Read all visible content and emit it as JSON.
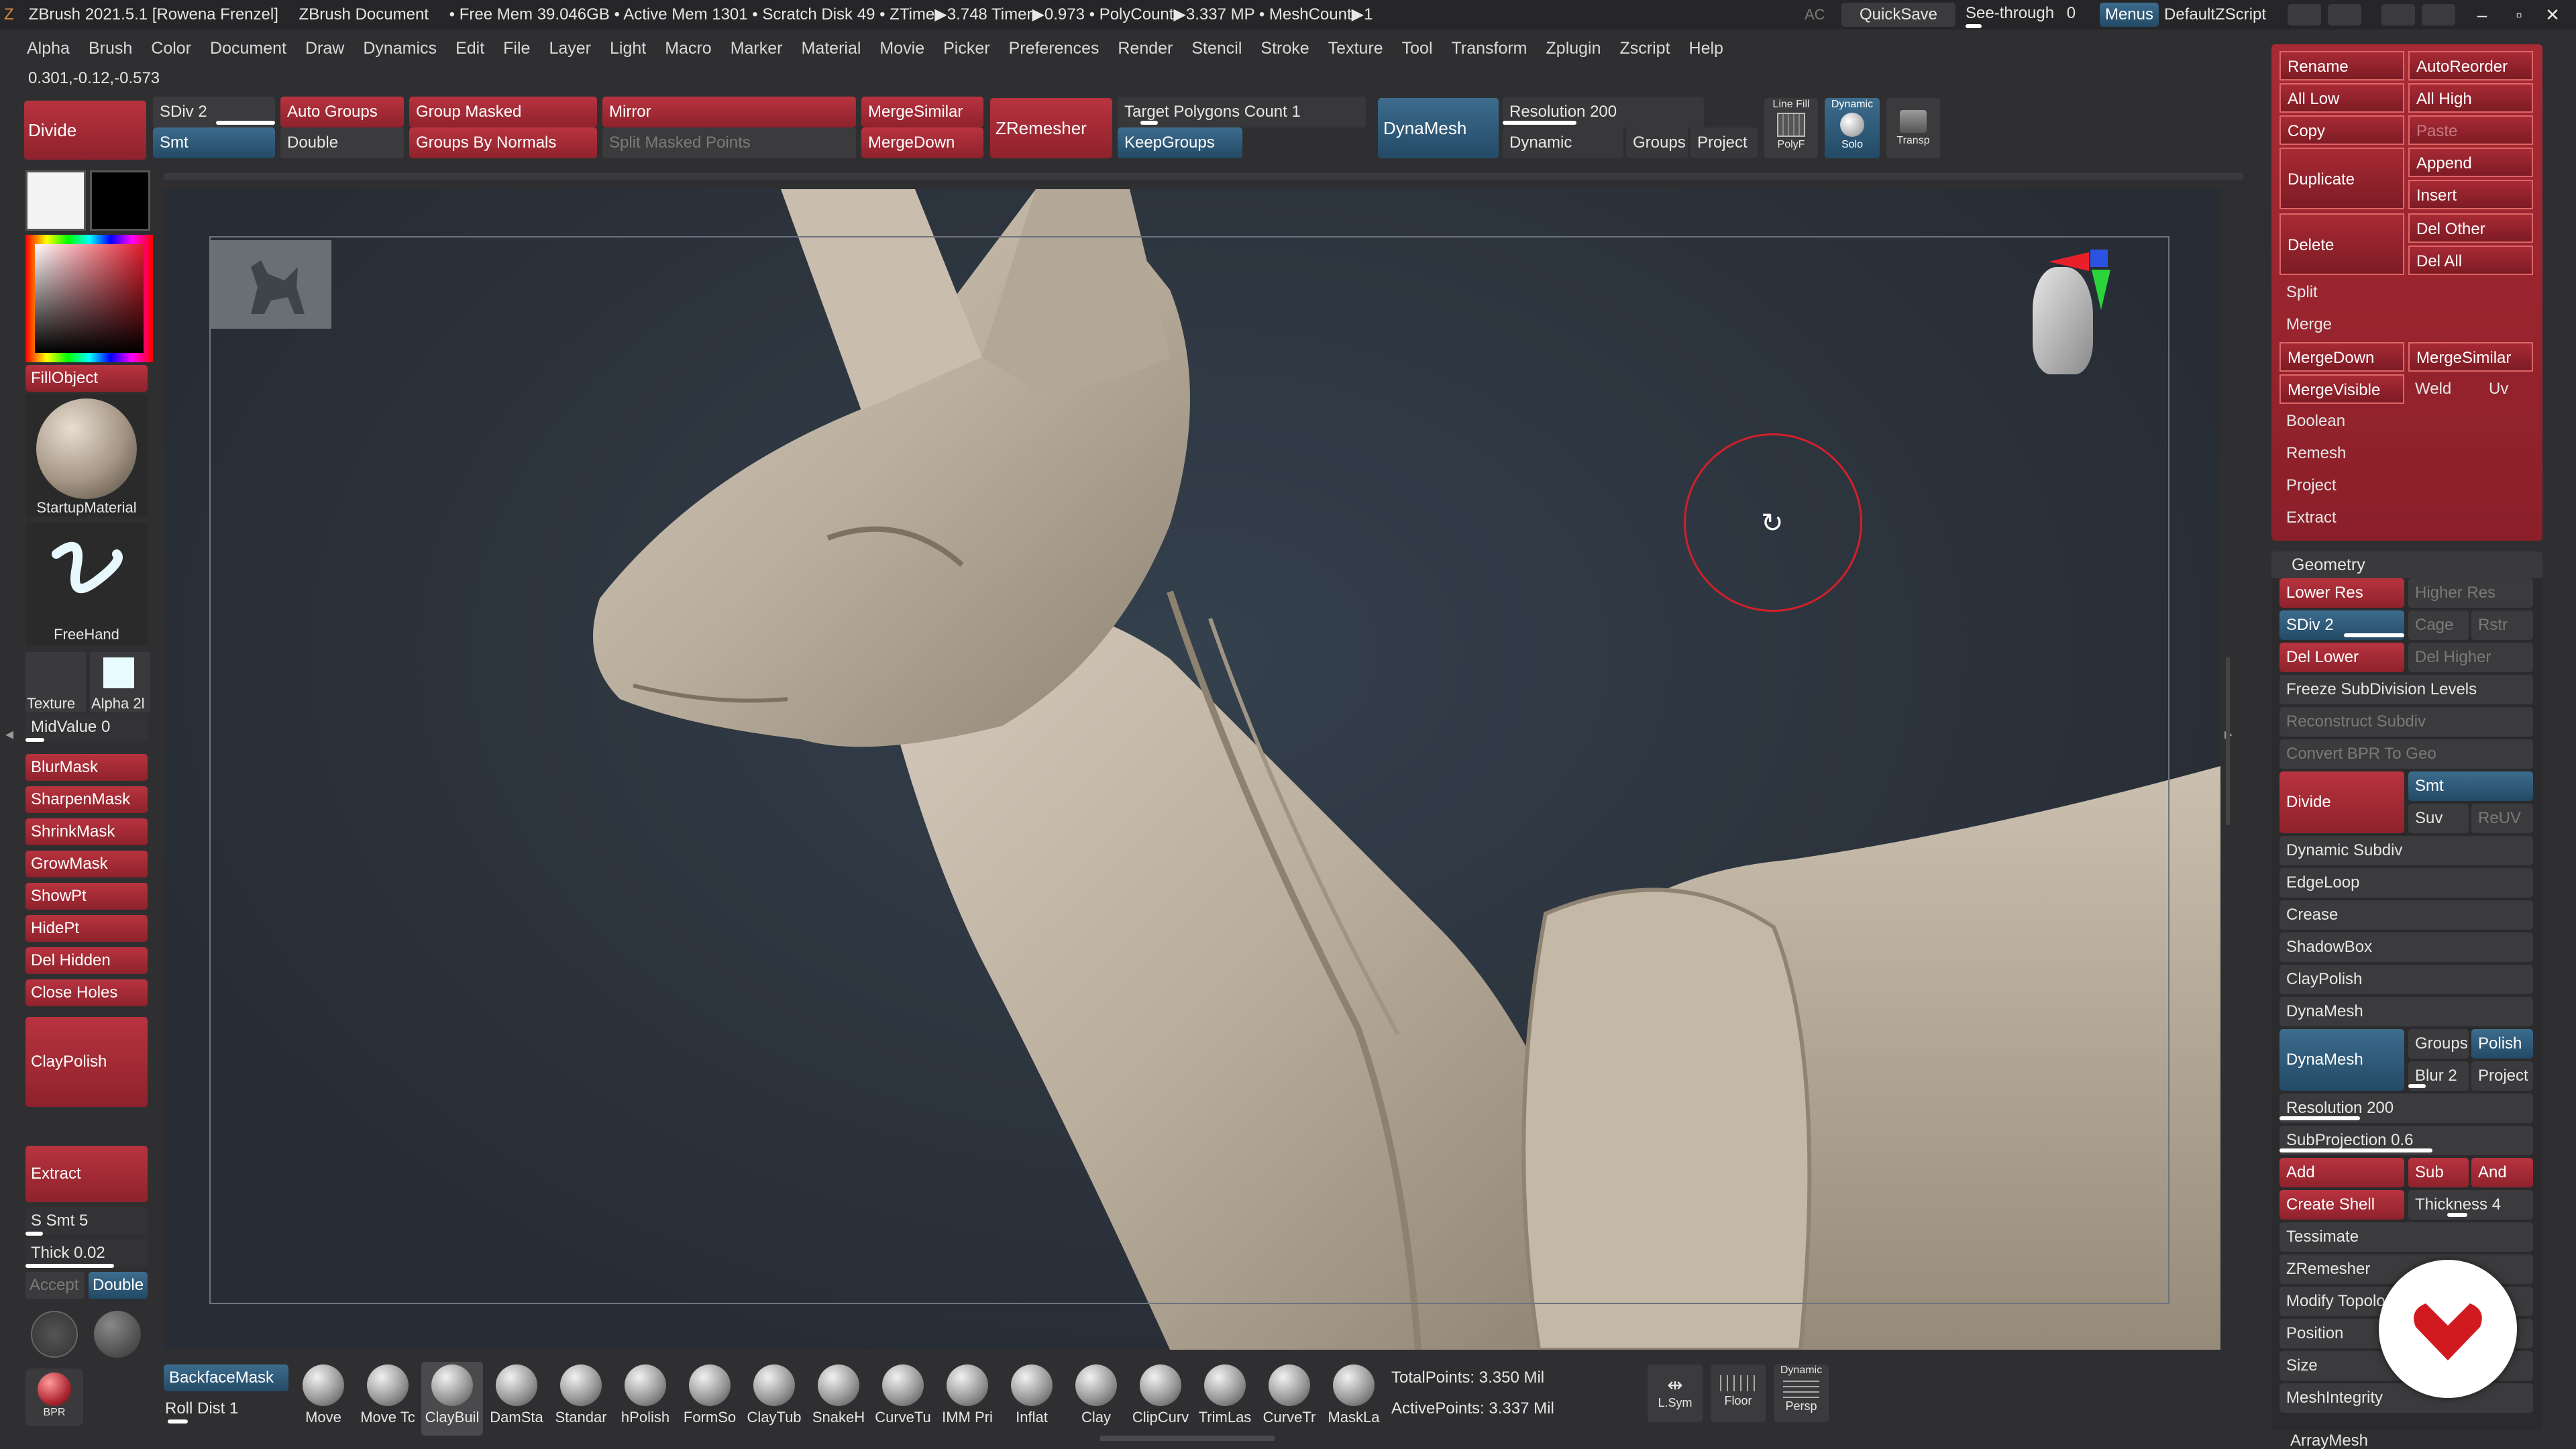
{
  "titlebar": {
    "app": "ZBrush 2021.5.1 [Rowena Frenzel]",
    "doc": "ZBrush Document",
    "stats": "• Free Mem 39.046GB • Active Mem 1301 • Scratch Disk 49 • ZTime▶3.748 Timer▶0.973 • PolyCount▶3.337 MP • MeshCount▶1",
    "ac": "AC",
    "quicksave": "QuickSave",
    "seethrough": "See-through",
    "seethrough_val": "0",
    "menus": "Menus",
    "zscript": "DefaultZScript"
  },
  "menubar": [
    "Alpha",
    "Brush",
    "Color",
    "Document",
    "Draw",
    "Dynamics",
    "Edit",
    "File",
    "Layer",
    "Light",
    "Macro",
    "Marker",
    "Material",
    "Movie",
    "Picker",
    "Preferences",
    "Render",
    "Stencil",
    "Stroke",
    "Texture",
    "Tool",
    "Transform",
    "Zplugin",
    "Zscript",
    "Help"
  ],
  "coords": "0.301,-0.12,-0.573",
  "toolbar": {
    "divide": "Divide",
    "sdiv": "SDiv 2",
    "smt": "Smt",
    "auto_groups": "Auto Groups",
    "double": "Double",
    "group_masked": "Group Masked",
    "groups_by_normals": "Groups By Normals",
    "mirror": "Mirror",
    "split_masked": "Split Masked Points",
    "merge_similar": "MergeSimilar",
    "merge_down": "MergeDown",
    "zremesher": "ZRemesher",
    "target_polygons": "Target Polygons Count 1",
    "keep_groups": "KeepGroups",
    "dynamesh": "DynaMesh",
    "resolution": "Resolution 200",
    "dynamic": "Dynamic",
    "groups": "Groups",
    "project": "Project",
    "line_fill": "Line Fill",
    "polyf": "PolyF",
    "dynamic_label": "Dynamic",
    "solo": "Solo",
    "transp": "Transp"
  },
  "leftpanel": {
    "fill_object": "FillObject",
    "material": "StartupMaterial",
    "stroke": "FreeHand",
    "texture": "Texture",
    "alpha": "Alpha 2l",
    "midvalue": "MidValue 0",
    "buttons": [
      "BlurMask",
      "SharpenMask",
      "ShrinkMask",
      "GrowMask",
      "ShowPt",
      "HidePt",
      "Del Hidden",
      "Close Holes"
    ],
    "claypolish": "ClayPolish",
    "extract": "Extract",
    "ssmt": "S Smt 5",
    "thick": "Thick 0.02",
    "accept": "Accept",
    "double": "Double",
    "bpr": "BPR"
  },
  "bottombar": {
    "backface": "BackfaceMask",
    "rolldist": "Roll Dist 1",
    "brushes": [
      "Move",
      "Move Tc",
      "ClayBuil",
      "DamSta",
      "Standar",
      "hPolish",
      "FormSo",
      "ClayTub",
      "SnakeH",
      "CurveTu",
      "IMM Pri",
      "Inflat",
      "Clay",
      "ClipCurv",
      "TrimLas",
      "CurveTr",
      "MaskLa"
    ],
    "total_points": "TotalPoints: 3.350 Mil",
    "active_points": "ActivePoints: 3.337 Mil",
    "lsym": "L.Sym",
    "floor": "Floor",
    "persp": "Persp",
    "dynamic": "Dynamic"
  },
  "subtool": {
    "rename": "Rename",
    "autoreorder": "AutoReorder",
    "alllow": "All Low",
    "allhigh": "All High",
    "copy": "Copy",
    "paste": "Paste",
    "duplicate": "Duplicate",
    "append": "Append",
    "insert": "Insert",
    "delete": "Delete",
    "delother": "Del Other",
    "delall": "Del All",
    "split": "Split",
    "merge": "Merge",
    "mergedown": "MergeDown",
    "mergesimilar": "MergeSimilar",
    "mergevisible": "MergeVisible",
    "weld": "Weld",
    "uv": "Uv",
    "boolean": "Boolean",
    "remesh": "Remesh",
    "project": "Project",
    "extract": "Extract"
  },
  "geometry": {
    "header": "Geometry",
    "lowerres": "Lower Res",
    "higherres": "Higher Res",
    "sdiv": "SDiv 2",
    "cage": "Cage",
    "rstr": "Rstr",
    "dellower": "Del Lower",
    "delhigher": "Del Higher",
    "freeze": "Freeze SubDivision Levels",
    "reconstruct": "Reconstruct Subdiv",
    "convert": "Convert BPR To Geo",
    "divide": "Divide",
    "smt": "Smt",
    "suv": "Suv",
    "reuv": "ReUV",
    "items1": [
      "Dynamic Subdiv",
      "EdgeLoop",
      "Crease",
      "ShadowBox",
      "ClayPolish",
      "DynaMesh"
    ],
    "dynamesh": "DynaMesh",
    "groups": "Groups",
    "polish": "Polish",
    "blur": "Blur 2",
    "project": "Project",
    "resolution": "Resolution 200",
    "subprojection": "SubProjection 0.6",
    "add": "Add",
    "sub": "Sub",
    "and": "And",
    "createshell": "Create Shell",
    "thickness": "Thickness 4",
    "items2": [
      "Tessimate",
      "ZRemesher",
      "Modify Topology",
      "Position",
      "Size",
      "MeshIntegrity"
    ],
    "arraymesh": "ArrayMesh"
  },
  "colors": {
    "accent_red": "#b8333f",
    "accent_blue": "#3d6c8d",
    "canvas": "#2c323b",
    "model": "#bfb3a3"
  }
}
